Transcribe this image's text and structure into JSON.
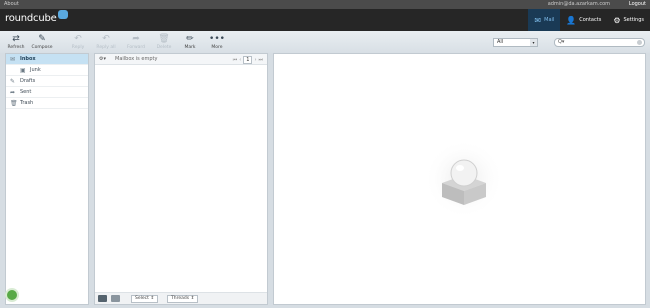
{
  "topline": {
    "about": "About",
    "user": "admin@da.azarkam.com",
    "logout": "Logout"
  },
  "header": {
    "logo": "roundcube"
  },
  "taskbar": [
    {
      "label": "Mail",
      "icon": "✉"
    },
    {
      "label": "Contacts",
      "icon": "👤"
    },
    {
      "label": "Settings",
      "icon": "⚙"
    }
  ],
  "toolbar": [
    {
      "label": "Refresh",
      "icon": "⇄"
    },
    {
      "label": "Compose",
      "icon": "✎"
    },
    {
      "label": "Reply",
      "icon": "↶"
    },
    {
      "label": "Reply all",
      "icon": "↶"
    },
    {
      "label": "Forward",
      "icon": "➦"
    },
    {
      "label": "Delete",
      "icon": "🗑"
    },
    {
      "label": "Mark",
      "icon": "✏"
    },
    {
      "label": "More",
      "icon": "•••"
    }
  ],
  "filter": {
    "value": "All"
  },
  "search": {
    "placeholder": "Q▾"
  },
  "folders": [
    {
      "label": "Inbox",
      "icon": "✉"
    },
    {
      "label": "Junk",
      "icon": "▣"
    },
    {
      "label": "Drafts",
      "icon": "✎"
    },
    {
      "label": "Sent",
      "icon": "➦"
    },
    {
      "label": "Trash",
      "icon": "🗑"
    }
  ],
  "messagelist": {
    "options": "⚙▾",
    "status": "Mailbox is empty",
    "page": "1",
    "select_label": "Select",
    "threads_label": "Threads"
  },
  "colors": {
    "accent": "#1a3a55",
    "selected": "#c5e1f3",
    "header": "#262626"
  }
}
